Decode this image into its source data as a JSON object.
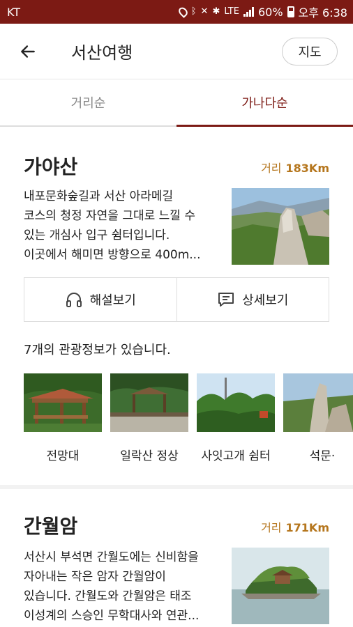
{
  "status_bar": {
    "carrier": "KT",
    "network": "LTE",
    "battery": "60%",
    "time": "오후 6:38"
  },
  "header": {
    "title": "서산여행",
    "map_button": "지도",
    "back_icon": "arrow-left-icon"
  },
  "tabs": [
    {
      "label": "거리순",
      "active": false
    },
    {
      "label": "가나다순",
      "active": true
    }
  ],
  "places": [
    {
      "name": "가야산",
      "distance_label": "거리",
      "distance_value": "183Km",
      "description_lines": [
        "내포문화숲길과 서산 아라메길",
        "코스의 청정 자연을 그대로 느낄 수",
        "있는 개심사 입구 쉼터입니다.",
        "이곳에서 해미면 방향으로 400m..."
      ],
      "actions": {
        "audio_guide": "해설보기",
        "detail": "상세보기"
      },
      "info_count_text": "7개의 관광정보가 있습니다.",
      "gallery": [
        {
          "label": "전망대"
        },
        {
          "label": "일락산 정상"
        },
        {
          "label": "사잇고개 쉼터"
        },
        {
          "label": "석문·"
        }
      ]
    },
    {
      "name": "간월암",
      "distance_label": "거리",
      "distance_value": "171Km",
      "description_lines": [
        "서산시 부석면 간월도에는 신비함을",
        "자아내는 작은 암자 간월암이",
        "있습니다. 간월도와 간월암은 태조",
        "이성계의 스승인 무학대사와 연관..."
      ]
    }
  ],
  "colors": {
    "brand": "#7c1a14",
    "distance": "#b5761d"
  }
}
